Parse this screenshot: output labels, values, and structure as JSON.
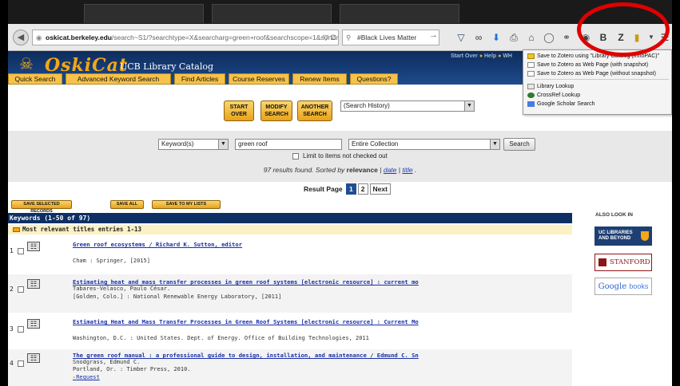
{
  "browser": {
    "url_host": "oskicat.berkeley.edu",
    "url_rest": "/search~S1/?searchtype=X&searcharg=green+roof&searchscope=1&sortdropdown=-&",
    "search_text": "#Black Lives Matter"
  },
  "zotero_menu": {
    "items": [
      "Save to Zotero using \"Library Catalog (InnoPAC)\"",
      "Save to Zotero as Web Page (with snapshot)",
      "Save to Zotero as Web Page (without snapshot)",
      "Library Lookup",
      "CrossRef Lookup",
      "Google Scholar Search"
    ]
  },
  "header": {
    "logo": "OskiCat",
    "subtitle": "UCB Library Catalog",
    "links": [
      "Start Over",
      "Help",
      "WH"
    ]
  },
  "nav": {
    "tabs": [
      "Quick Search",
      "Advanced Keyword Search",
      "Find Articles",
      "Course Reserves",
      "Renew Items",
      "Questions?"
    ]
  },
  "actions": {
    "start_over_1": "START",
    "start_over_2": "OVER",
    "modify_1": "MODIFY",
    "modify_2": "SEARCH",
    "another_1": "ANOTHER",
    "another_2": "SEARCH",
    "history": "(Search History)"
  },
  "search": {
    "type": "Keyword(s)",
    "query": "green roof",
    "collection": "Entire Collection",
    "button": "Search",
    "limit_label": "Limit to items not checked out",
    "results_prefix": "97 results found. Sorted by",
    "sort_current": "relevance",
    "sort_date": "date",
    "sort_title": "title"
  },
  "paging": {
    "label": "Result Page",
    "pages": [
      "1",
      "2"
    ],
    "next": "Next"
  },
  "save_buttons": [
    "SAVE SELECTED RECORDS",
    "SAVE ALL",
    "SAVE TO MY LISTS"
  ],
  "results_header": "Keywords (1-50 of 97)",
  "relevant_header": "Most relevant titles entries 1-13",
  "results": [
    {
      "num": "1",
      "title": "Green roof ecosystems / Richard K. Sutton, editor",
      "lines": [
        "",
        "Cham : Springer, [2015]"
      ]
    },
    {
      "num": "2",
      "title": "Estimating heat and mass transfer processes in green roof systems [electronic resource] : current mo",
      "lines": [
        "Tabares-Velasco, Paulo César.",
        "[Golden, Colo.] : National Renewable Energy Laboratory, [2011]"
      ]
    },
    {
      "num": "3",
      "title": "Estimating Heat and Mass Transfer Processes in Green Roof Systems [electronic resource] : Current Mo",
      "lines": [
        "",
        "Washington, D.C. : United States. Dept. of Energy. Office of Building Technologies, 2011"
      ]
    },
    {
      "num": "4",
      "title": "The green roof manual : a professional guide to design, installation, and maintenance / Edmund C. Sn",
      "lines": [
        "Snodgrass, Edmund C.",
        "Portland, Or. : Timber Press, 2010."
      ],
      "request": "Request"
    }
  ],
  "sidebar": {
    "also_look": "ALSO LOOK IN",
    "uc_lib_1": "UC LIBRARIES",
    "uc_lib_2": "AND BEYOND",
    "stanford": "STANFORD",
    "google_1": "Google",
    "google_2": "books"
  }
}
